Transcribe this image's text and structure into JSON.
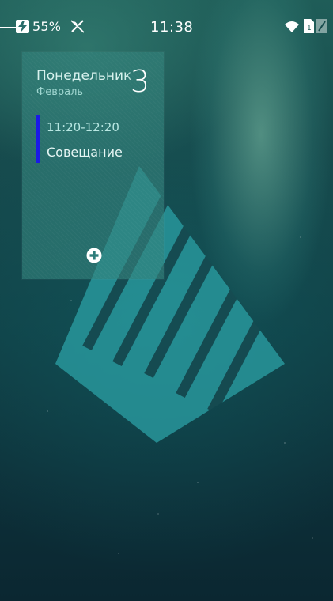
{
  "status_bar": {
    "battery_percent": "55%",
    "time": "11:38",
    "icons": [
      "battery-charging-icon",
      "gps-off-icon",
      "wifi-icon",
      "sim-icon",
      "signal-icon"
    ]
  },
  "calendar_widget": {
    "day_name": "Понедельник",
    "day_number": "3",
    "month": "Февраль",
    "event": {
      "time": "11:20-12:20",
      "title": "Совещание",
      "color": "#1a1ae6"
    },
    "add_icon": "plus-circle-icon"
  },
  "wallpaper": {
    "logo": "sailfish-logo-icon",
    "logo_color": "#2a9ba0"
  }
}
